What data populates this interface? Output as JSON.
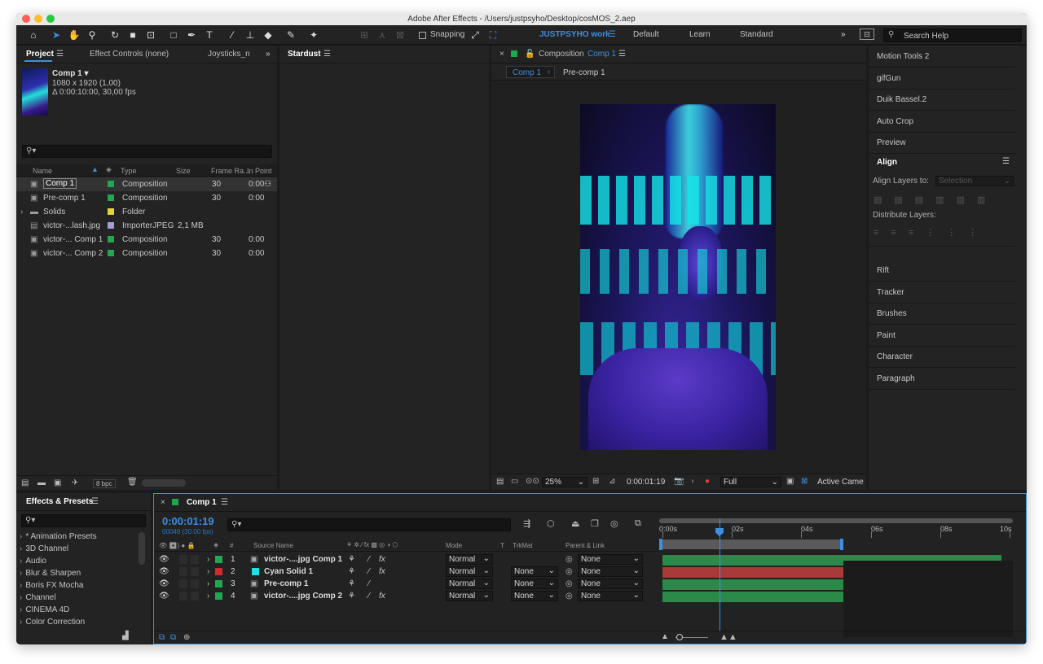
{
  "app": {
    "title": "Adobe After Effects - /Users/justpsyho/Desktop/cosMOS_2.aep"
  },
  "toolbar": {
    "snapping": "Snapping",
    "workspaces": [
      "JUSTPSYHO work",
      "Default",
      "Learn",
      "Standard"
    ],
    "search_help": "Search Help"
  },
  "project": {
    "tabs": [
      "Project",
      "Effect Controls (none)",
      "Joysticks_n"
    ],
    "selected_name": "Comp 1 ▾",
    "selected_size": "1080 x 1920 (1,00)",
    "selected_duration": "Δ 0:00:10:00, 30,00 fps",
    "columns": [
      "Name",
      "Type",
      "Size",
      "Frame Ra...",
      "In Point"
    ],
    "items": [
      {
        "name": "Comp 1",
        "type": "Composition",
        "size": "",
        "fps": "30",
        "in": "0:00",
        "color": "#1fa84f"
      },
      {
        "name": "Pre-comp 1",
        "type": "Composition",
        "size": "",
        "fps": "30",
        "in": "0:00",
        "color": "#1fa84f"
      },
      {
        "name": "Solids",
        "type": "Folder",
        "size": "",
        "fps": "",
        "in": "",
        "color": "#e3d43a"
      },
      {
        "name": "victor-...lash.jpg",
        "type": "ImporterJPEG",
        "size": "2,1 MB",
        "fps": "",
        "in": "",
        "color": "#a99bd6"
      },
      {
        "name": "victor-... Comp 1",
        "type": "Composition",
        "size": "",
        "fps": "30",
        "in": "0:00",
        "color": "#1fa84f"
      },
      {
        "name": "victor-... Comp 2",
        "type": "Composition",
        "size": "",
        "fps": "30",
        "in": "0:00",
        "color": "#1fa84f"
      }
    ],
    "bpc": "8 bpc"
  },
  "stardust": {
    "title": "Stardust"
  },
  "composition": {
    "label": "Composition",
    "name": "Comp 1",
    "nav": [
      "Comp 1",
      "Pre-comp 1"
    ],
    "zoom": "25%",
    "timecode": "0:00:01:19",
    "resolution": "Full",
    "camera": "Active Came"
  },
  "right_panels": {
    "items_top": [
      "Motion Tools 2",
      "gifGun",
      "Duik Bassel.2",
      "Auto Crop",
      "Preview"
    ],
    "align_title": "Align",
    "align_layers_to": "Align Layers to:",
    "selection": "Selection",
    "distribute": "Distribute Layers:",
    "items_bottom": [
      "Rift",
      "Tracker",
      "Brushes",
      "Paint",
      "Character",
      "Paragraph"
    ]
  },
  "effects": {
    "title": "Effects & Presets",
    "items": [
      "* Animation Presets",
      "3D Channel",
      "Audio",
      "Blur & Sharpen",
      "Boris FX Mocha",
      "Channel",
      "CINEMA 4D",
      "Color Correction"
    ]
  },
  "timeline": {
    "tab": "Comp 1",
    "timecode": "0:00:01:19",
    "frames": "00049 (30.00 fps)",
    "columns": {
      "num": "#",
      "source": "Source Name",
      "mode": "Mode",
      "t": "T",
      "trkmat": "TrkMat",
      "parent": "Parent & Link"
    },
    "ruler": [
      "0:00s",
      "02s",
      "04s",
      "06s",
      "08s",
      "10s"
    ],
    "playhead_seconds": 1.633,
    "work_area_end_seconds": 5.2,
    "layers": [
      {
        "num": "1",
        "name": "victor-....jpg Comp 1",
        "label": "#1fa84f",
        "mode": "Normal",
        "trkmat": "",
        "parent": "None",
        "bar": "#2b8a4a",
        "fx": true
      },
      {
        "num": "2",
        "name": "Cyan Solid 1",
        "label": "#d32b2b",
        "mode": "Normal",
        "trkmat": "None",
        "parent": "None",
        "bar": "#a83a3a",
        "fx": true
      },
      {
        "num": "3",
        "name": "Pre-comp 1",
        "label": "#1fa84f",
        "mode": "Normal",
        "trkmat": "None",
        "parent": "None",
        "bar": "#2b8a4a",
        "fx": false
      },
      {
        "num": "4",
        "name": "victor-....jpg Comp 2",
        "label": "#1fa84f",
        "mode": "Normal",
        "trkmat": "None",
        "parent": "None",
        "bar": "#2b8a4a",
        "fx": true
      }
    ]
  }
}
